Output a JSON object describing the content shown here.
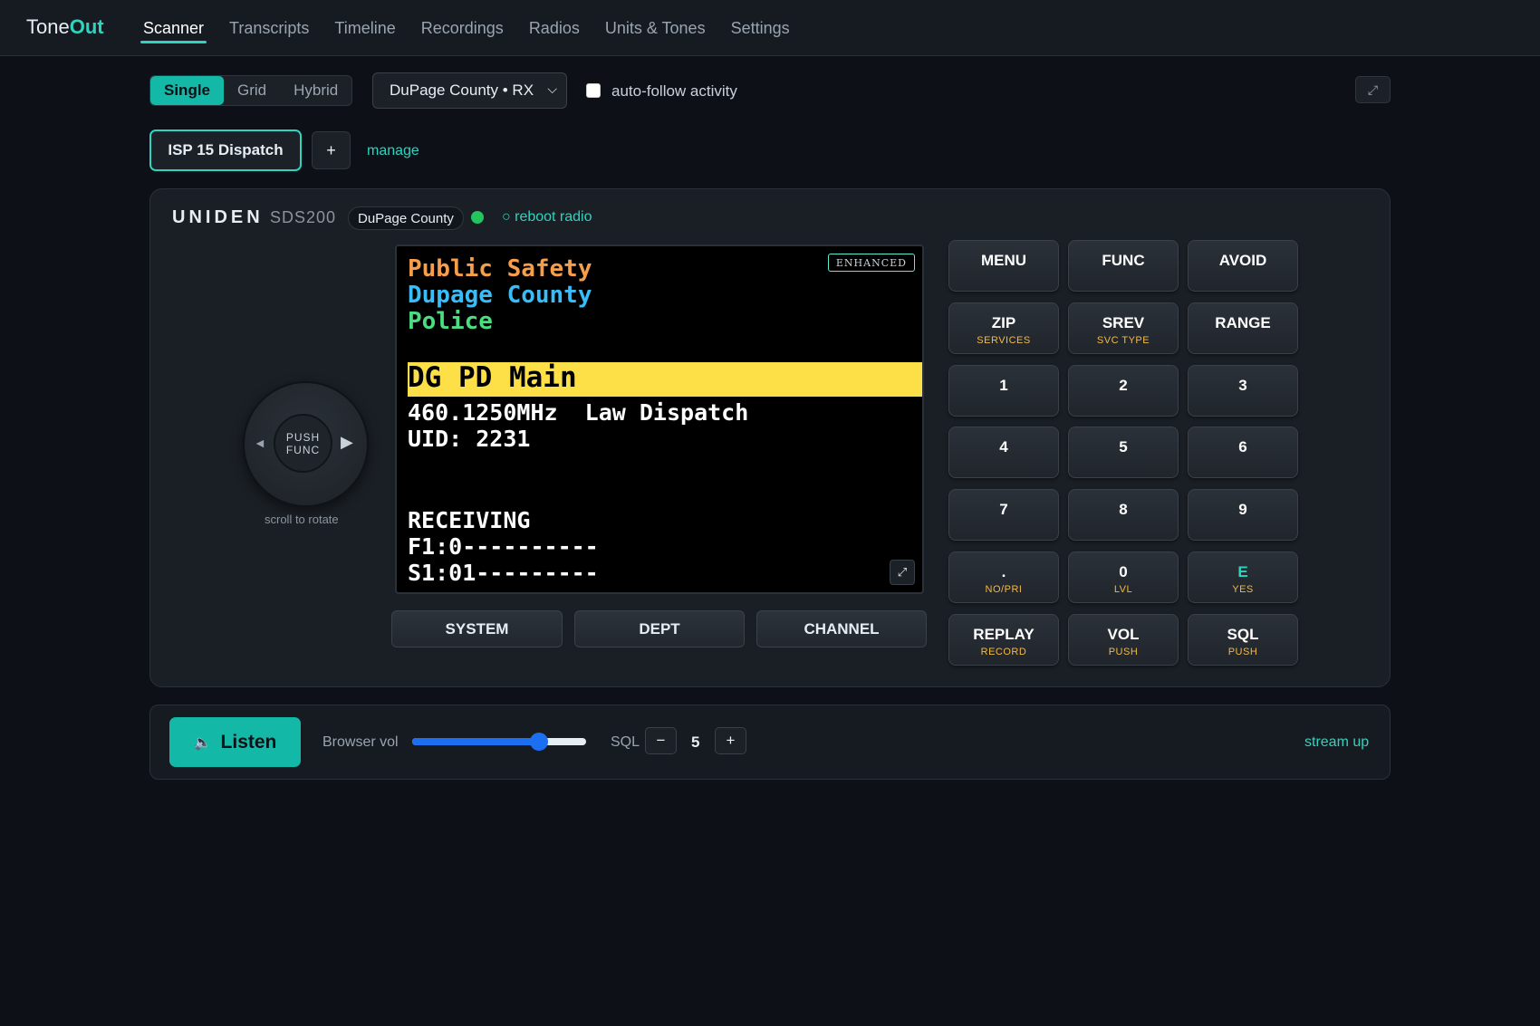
{
  "brand": {
    "part1": "Tone",
    "part2": "Out"
  },
  "nav": [
    {
      "label": "Scanner",
      "active": true
    },
    {
      "label": "Transcripts"
    },
    {
      "label": "Timeline"
    },
    {
      "label": "Recordings"
    },
    {
      "label": "Radios"
    },
    {
      "label": "Units & Tones"
    },
    {
      "label": "Settings"
    }
  ],
  "view_modes": [
    "Single",
    "Grid",
    "Hybrid"
  ],
  "view_mode_selected": "Single",
  "radio_select": {
    "value": "DuPage County • RX"
  },
  "auto_follow": {
    "label": "auto-follow activity",
    "checked": false
  },
  "expand_icon": "⤢",
  "radio_tabs": {
    "active": "ISP 15 Dispatch",
    "add": "+",
    "manage": "manage"
  },
  "scanner": {
    "brand": "UNIDEN",
    "model": "SDS200",
    "county": "DuPage County",
    "status": "online",
    "status_color": "#22c55e",
    "reboot": "○ reboot radio",
    "knob": {
      "push": "PUSH",
      "func": "FUNC",
      "left": "◄",
      "right": "▶",
      "caption": "scroll to rotate"
    },
    "display": {
      "badge": "ENHANCED",
      "system": "Public Safety",
      "department": "Dupage County",
      "group": "Police",
      "channel": "DG PD Main",
      "freq_line": "460.1250MHz  Law Dispatch",
      "uid_line": "UID: 2231",
      "status_line": "RECEIVING",
      "f1_line": "F1:0----------",
      "s1_line": "S1:01---------"
    },
    "screen_buttons": [
      "SYSTEM",
      "DEPT",
      "CHANNEL"
    ],
    "keys": [
      {
        "label": "MENU",
        "sub": ""
      },
      {
        "label": "FUNC",
        "sub": ""
      },
      {
        "label": "AVOID",
        "sub": ""
      },
      {
        "label": "ZIP",
        "sub": "SERVICES"
      },
      {
        "label": "SREV",
        "sub": "SVC TYPE"
      },
      {
        "label": "RANGE",
        "sub": ""
      },
      {
        "label": "1",
        "sub": ""
      },
      {
        "label": "2",
        "sub": ""
      },
      {
        "label": "3",
        "sub": ""
      },
      {
        "label": "4",
        "sub": ""
      },
      {
        "label": "5",
        "sub": ""
      },
      {
        "label": "6",
        "sub": ""
      },
      {
        "label": "7",
        "sub": ""
      },
      {
        "label": "8",
        "sub": ""
      },
      {
        "label": "9",
        "sub": ""
      },
      {
        "label": ".",
        "sub": "NO/PRI"
      },
      {
        "label": "0",
        "sub": "LVL"
      },
      {
        "label": "E",
        "sub": "YES"
      },
      {
        "label": "REPLAY",
        "sub": "RECORD"
      },
      {
        "label": "VOL",
        "sub": "PUSH"
      },
      {
        "label": "SQL",
        "sub": "PUSH"
      }
    ]
  },
  "audio": {
    "listen_icon": "🔈",
    "listen": "Listen",
    "vol_label": "Browser vol",
    "browser_volume_pct": 73,
    "sql_label": "SQL",
    "sql_minus": "−",
    "sql_value": "5",
    "sql_plus": "+",
    "stream_status": "stream up"
  }
}
